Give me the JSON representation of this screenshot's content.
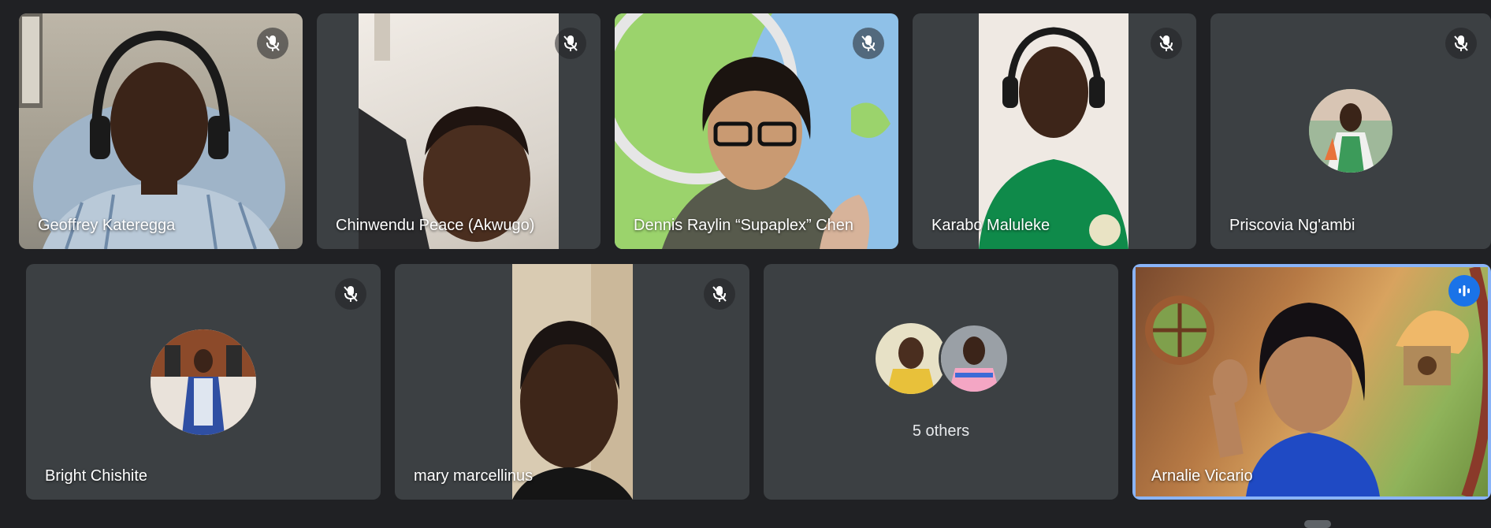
{
  "participants": [
    {
      "name": "Geoffrey Kateregga",
      "muted": true
    },
    {
      "name": "Chinwendu Peace (Akwugo)",
      "muted": true
    },
    {
      "name": "Dennis Raylin “Supaplex” Chen",
      "muted": true
    },
    {
      "name": "Karabo Maluleke",
      "muted": true
    },
    {
      "name": "Priscovia Ng'ambi",
      "muted": true
    },
    {
      "name": "Bright Chishite",
      "muted": true
    },
    {
      "name": "mary marcellinus",
      "muted": true
    },
    {
      "name": "Arnalie Vicario",
      "muted": false,
      "speaking": true
    }
  ],
  "others": {
    "label": "5 others"
  },
  "icons": {
    "mute": "mic-off-icon",
    "speaking": "audio-level-icon"
  },
  "colors": {
    "background": "#202124",
    "tile": "#3c4043",
    "speaking_border": "#8ab4f8",
    "speaking_badge": "#1a73e8"
  }
}
